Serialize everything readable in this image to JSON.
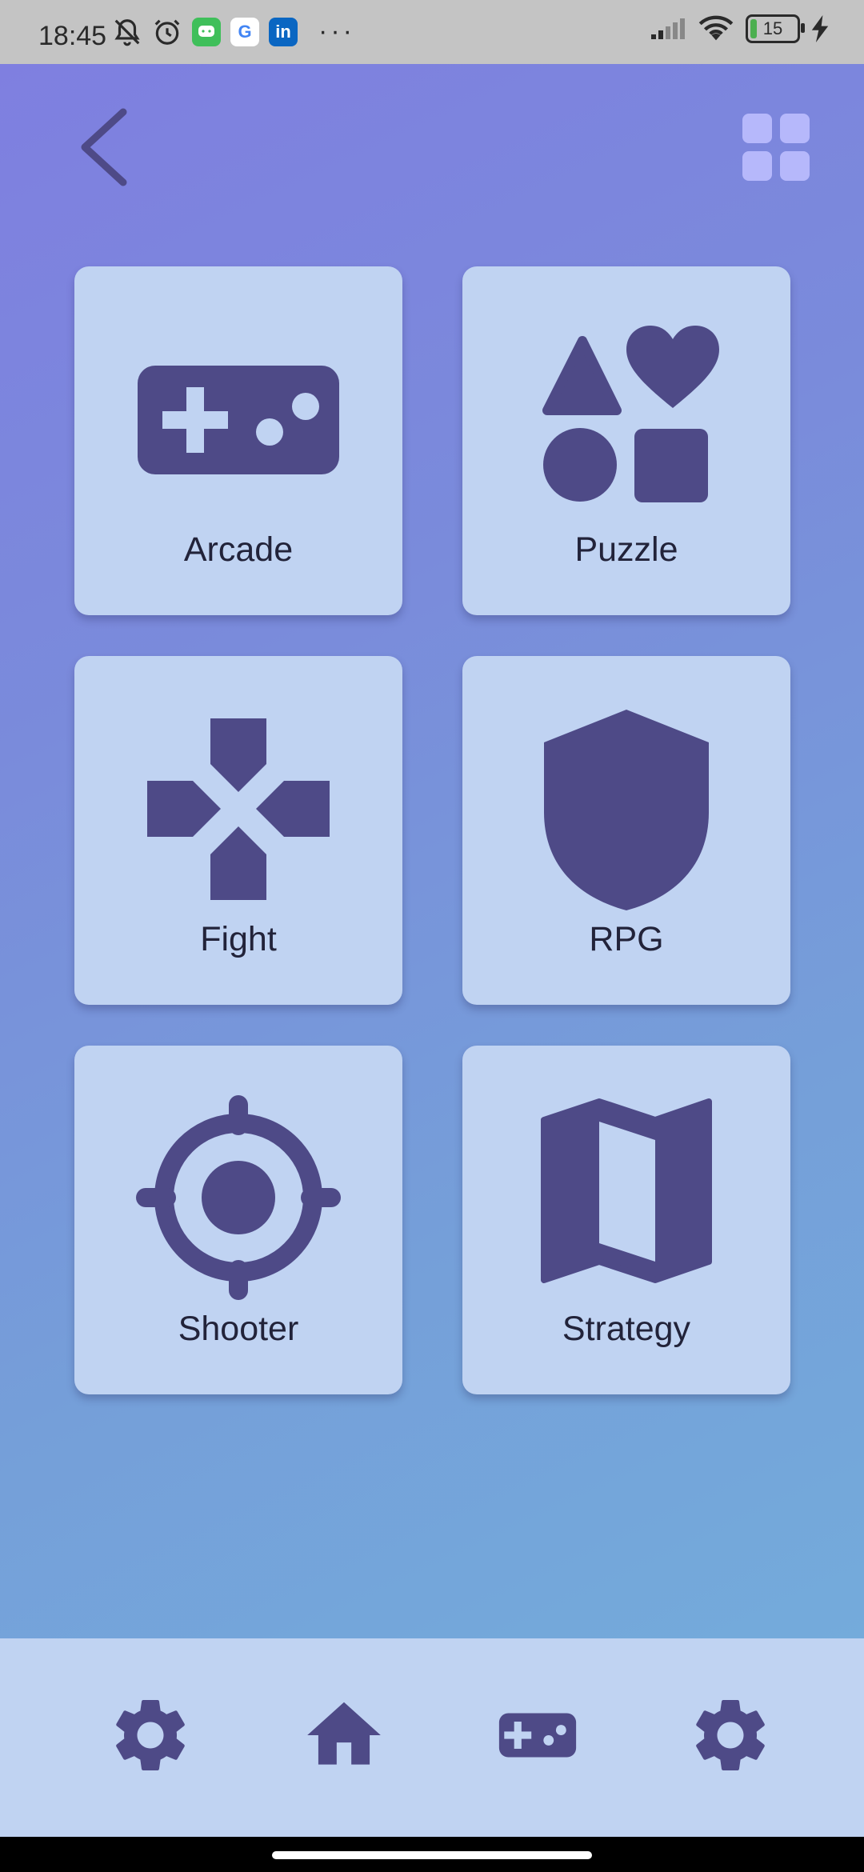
{
  "status_bar": {
    "time": "18:45",
    "battery_percent": "15",
    "battery_level": 0.15,
    "icons": [
      "bell-off-icon",
      "alarm-icon",
      "messenger-icon",
      "google-icon",
      "linkedin-icon",
      "more-dots-icon",
      "signal-icon",
      "wifi-icon",
      "battery-icon",
      "charging-icon"
    ],
    "more": "···"
  },
  "header": {
    "back_icon": "chevron-left-icon",
    "layout_icon": "grid-view-icon"
  },
  "categories": [
    {
      "label": "Arcade",
      "icon": "gamepad-icon"
    },
    {
      "label": "Puzzle",
      "icon": "shapes-icon"
    },
    {
      "label": "Fight",
      "icon": "dpad-icon"
    },
    {
      "label": "RPG",
      "icon": "shield-icon"
    },
    {
      "label": "Shooter",
      "icon": "crosshair-icon"
    },
    {
      "label": "Strategy",
      "icon": "map-icon"
    }
  ],
  "bottom_nav": {
    "items": [
      "settings-icon",
      "home-icon",
      "gamepad-icon",
      "settings-icon"
    ]
  },
  "colors": {
    "icon": "#4e4a87",
    "card": "#c0d3f2",
    "grid_icon": "#b6b8fb",
    "gradient_start": "#7f7fe0",
    "gradient_end": "#74abdb"
  }
}
